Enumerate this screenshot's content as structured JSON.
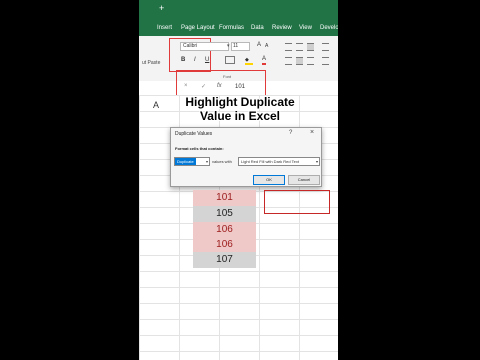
{
  "titlebar": {
    "plus": "+"
  },
  "menu": [
    "Insert",
    "Page Layout",
    "Formulas",
    "Data",
    "Review",
    "View",
    "Develo"
  ],
  "ribbon": {
    "paste_fragment": "ut Paste",
    "font_name": "Calibri",
    "font_size": "11",
    "grow_font": "A",
    "shrink_font": "A",
    "bold": "B",
    "italic": "I",
    "underline": "U",
    "font_color": "A",
    "font_group_label": "Font"
  },
  "formula_bar": {
    "cancel": "×",
    "enter": "✓",
    "fx": "fx",
    "value": "101"
  },
  "grid": {
    "column_a": "A"
  },
  "headline": {
    "line1": "Highlight Duplicate",
    "line2": "Value in Excel"
  },
  "dialog": {
    "title": "Duplicate Values",
    "help": "?",
    "close": "×",
    "label": "Format cells that contain:",
    "type_value": "Duplicate",
    "values_with": "values with",
    "format_value": "Light Red Fill with Dark Red Text",
    "ok": "OK",
    "cancel": "Cancel"
  },
  "cells": [
    {
      "value": "101",
      "duplicate": true
    },
    {
      "value": "105",
      "duplicate": false
    },
    {
      "value": "106",
      "duplicate": true
    },
    {
      "value": "106",
      "duplicate": true
    },
    {
      "value": "107",
      "duplicate": false
    }
  ],
  "colors": {
    "excel_green": "#217346",
    "duplicate_fill": "#efc8c8",
    "duplicate_text": "#9c1c1c",
    "highlight_box": "#e03a3a"
  }
}
